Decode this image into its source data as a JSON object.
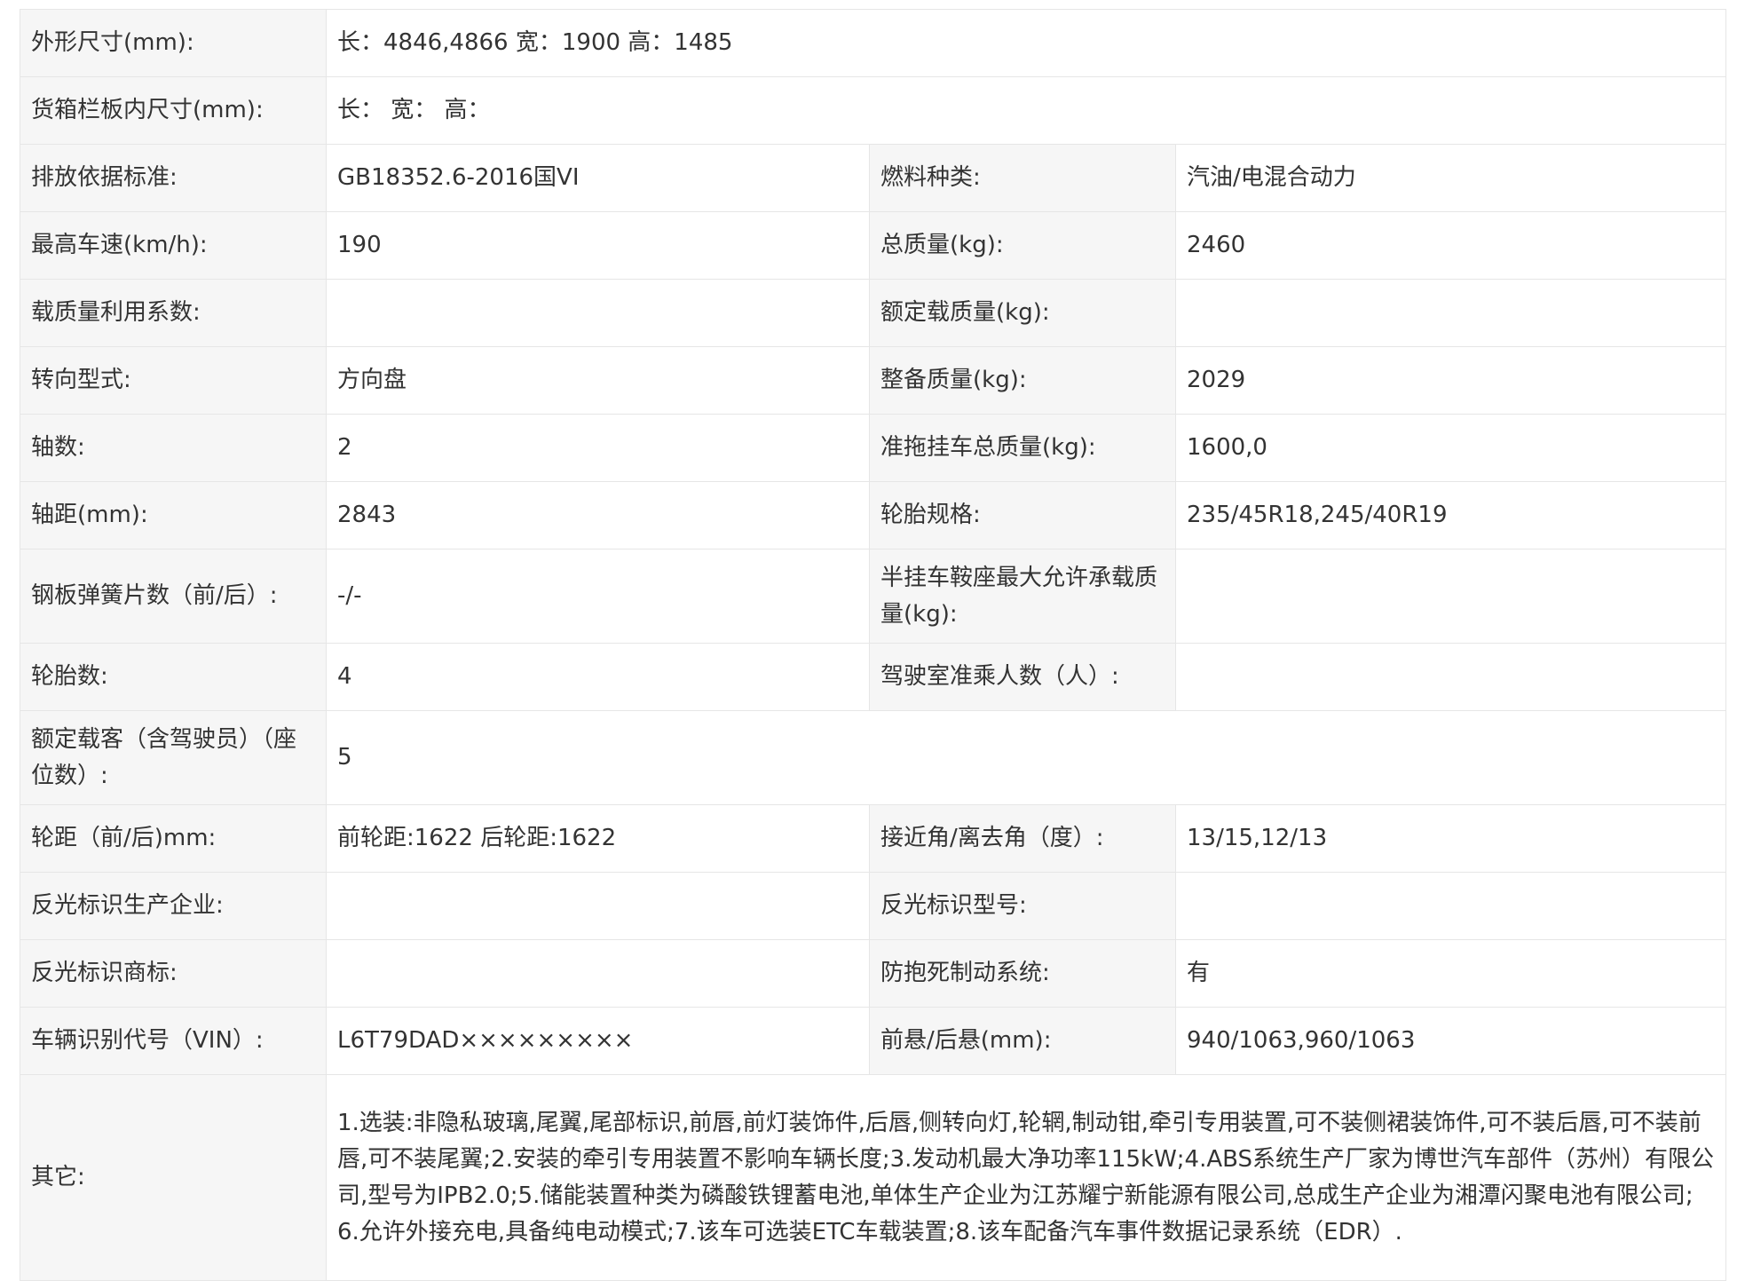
{
  "rows": [
    {
      "l1": "外形尺寸(mm):",
      "v1": "长：4846,4866 宽：1900 高：1485",
      "span": true
    },
    {
      "l1": "货箱栏板内尺寸(mm):",
      "v1": "长：  宽：  高：",
      "span": true
    },
    {
      "l1": "排放依据标准:",
      "v1": "GB18352.6-2016国VI",
      "l2": "燃料种类:",
      "v2": "汽油/电混合动力"
    },
    {
      "l1": "最高车速(km/h):",
      "v1": "190",
      "l2": "总质量(kg):",
      "v2": "2460"
    },
    {
      "l1": "载质量利用系数:",
      "v1": "",
      "l2": "额定载质量(kg):",
      "v2": ""
    },
    {
      "l1": "转向型式:",
      "v1": "方向盘",
      "l2": "整备质量(kg):",
      "v2": "2029"
    },
    {
      "l1": "轴数:",
      "v1": "2",
      "l2": "准拖挂车总质量(kg):",
      "v2": "1600,0"
    },
    {
      "l1": "轴距(mm):",
      "v1": "2843",
      "l2": "轮胎规格:",
      "v2": "235/45R18,245/40R19"
    },
    {
      "l1": "钢板弹簧片数（前/后）:",
      "v1": "-/-",
      "l2": "半挂车鞍座最大允许承载质量(kg):",
      "v2": ""
    },
    {
      "l1": "轮胎数:",
      "v1": "4",
      "l2": "驾驶室准乘人数（人）:",
      "v2": ""
    },
    {
      "l1": "额定载客（含驾驶员）（座位数）:",
      "v1": "5",
      "span": true
    },
    {
      "l1": "轮距（前/后)mm:",
      "v1": "前轮距:1622 后轮距:1622",
      "l2": "接近角/离去角（度）:",
      "v2": "13/15,12/13"
    },
    {
      "l1": "反光标识生产企业:",
      "v1": "",
      "l2": "反光标识型号:",
      "v2": ""
    },
    {
      "l1": "反光标识商标:",
      "v1": "",
      "l2": "防抱死制动系统:",
      "v2": "有"
    },
    {
      "l1": "车辆识别代号（VIN）:",
      "v1": "L6T79DAD×××××××××",
      "l2": "前悬/后悬(mm):",
      "v2": "940/1063,960/1063"
    },
    {
      "l1": "其它:",
      "v1": "1.选装:非隐私玻璃,尾翼,尾部标识,前唇,前灯装饰件,后唇,侧转向灯,轮辋,制动钳,牵引专用装置,可不装侧裙装饰件,可不装后唇,可不装前唇,可不装尾翼;2.安装的牵引专用装置不影响车辆长度;3.发动机最大净功率115kW;4.ABS系统生产厂家为博世汽车部件（苏州）有限公司,型号为IPB2.0;5.储能装置种类为磷酸铁锂蓄电池,单体生产企业为江苏耀宁新能源有限公司,总成生产企业为湘潭闪聚电池有限公司;6.允许外接充电,具备纯电动模式;7.该车可选装ETC车载装置;8.该车配备汽车事件数据记录系统（EDR）.",
      "span": true,
      "other": true
    }
  ]
}
